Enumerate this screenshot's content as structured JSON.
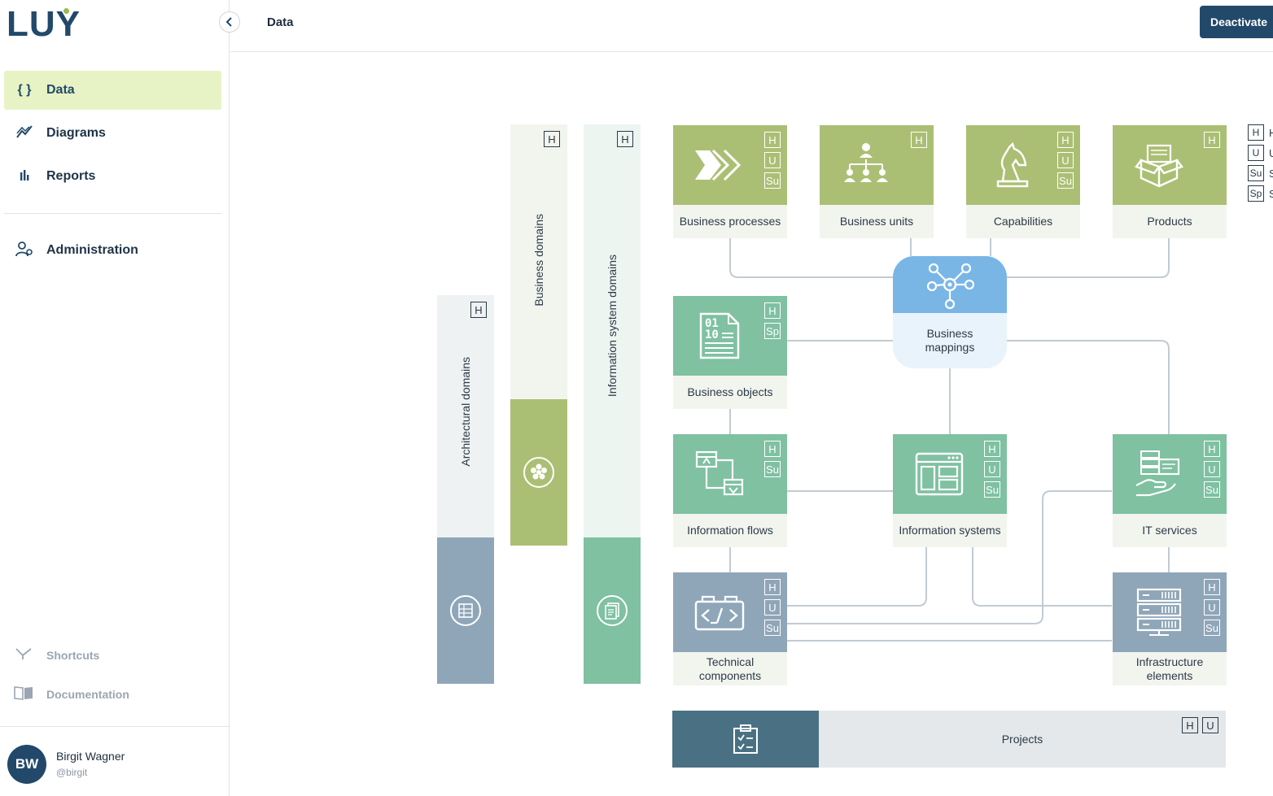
{
  "app": {
    "logo": "LUY"
  },
  "sidebar": {
    "items": [
      {
        "label": "Data",
        "icon": "braces-icon",
        "active": true
      },
      {
        "label": "Diagrams",
        "icon": "line-chart-icon"
      },
      {
        "label": "Reports",
        "icon": "bar-chart-icon"
      },
      {
        "label": "Administration",
        "icon": "user-gear-icon"
      }
    ],
    "footer_links": [
      {
        "label": "Shortcuts",
        "icon": "shortcuts-icon"
      },
      {
        "label": "Documentation",
        "icon": "book-icon"
      }
    ],
    "user": {
      "initials": "BW",
      "name": "Birgit Wagner",
      "handle": "@birgit"
    }
  },
  "header": {
    "title": "Data",
    "action_label": "Deactivate"
  },
  "colors": {
    "primary": "#22496a",
    "green": "#abbf74",
    "teal": "#7fc1a1",
    "slate": "#8fa6b9",
    "blue": "#79b6e6",
    "active_nav": "#e7f3c4"
  },
  "diagram": {
    "domains": [
      {
        "label": "Architectural domains",
        "badge": "H"
      },
      {
        "label": "Business domains",
        "badge": "H"
      },
      {
        "label": "Information system domains",
        "badge": "H"
      }
    ],
    "tiles": {
      "business_processes": {
        "label": "Business processes",
        "badges": [
          "H",
          "U",
          "Su"
        ]
      },
      "business_units": {
        "label": "Business units",
        "badges": [
          "H"
        ]
      },
      "capabilities": {
        "label": "Capabilities",
        "badges": [
          "H",
          "U",
          "Su"
        ]
      },
      "products": {
        "label": "Products",
        "badges": [
          "H"
        ]
      },
      "business_objects": {
        "label": "Business objects",
        "badges": [
          "H",
          "Sp"
        ]
      },
      "business_mappings": {
        "label": "Business mappings"
      },
      "information_flows": {
        "label": "Information flows",
        "badges": [
          "H",
          "Su"
        ]
      },
      "information_systems": {
        "label": "Information systems",
        "badges": [
          "H",
          "U",
          "Su"
        ]
      },
      "it_services": {
        "label": "IT services",
        "badges": [
          "H",
          "U",
          "Su"
        ]
      },
      "technical_components": {
        "label": "Technical components",
        "badges": [
          "H",
          "U",
          "Su"
        ]
      },
      "infrastructure_elements": {
        "label": "Infrastructure elements",
        "badges": [
          "H",
          "U",
          "Su"
        ]
      }
    },
    "projects": {
      "label": "Projects",
      "badges": [
        "H",
        "U"
      ]
    },
    "legend": [
      {
        "badge": "H",
        "text": "H"
      },
      {
        "badge": "U",
        "text": "U"
      },
      {
        "badge": "Su",
        "text": "S"
      },
      {
        "badge": "Sp",
        "text": "S"
      }
    ]
  }
}
